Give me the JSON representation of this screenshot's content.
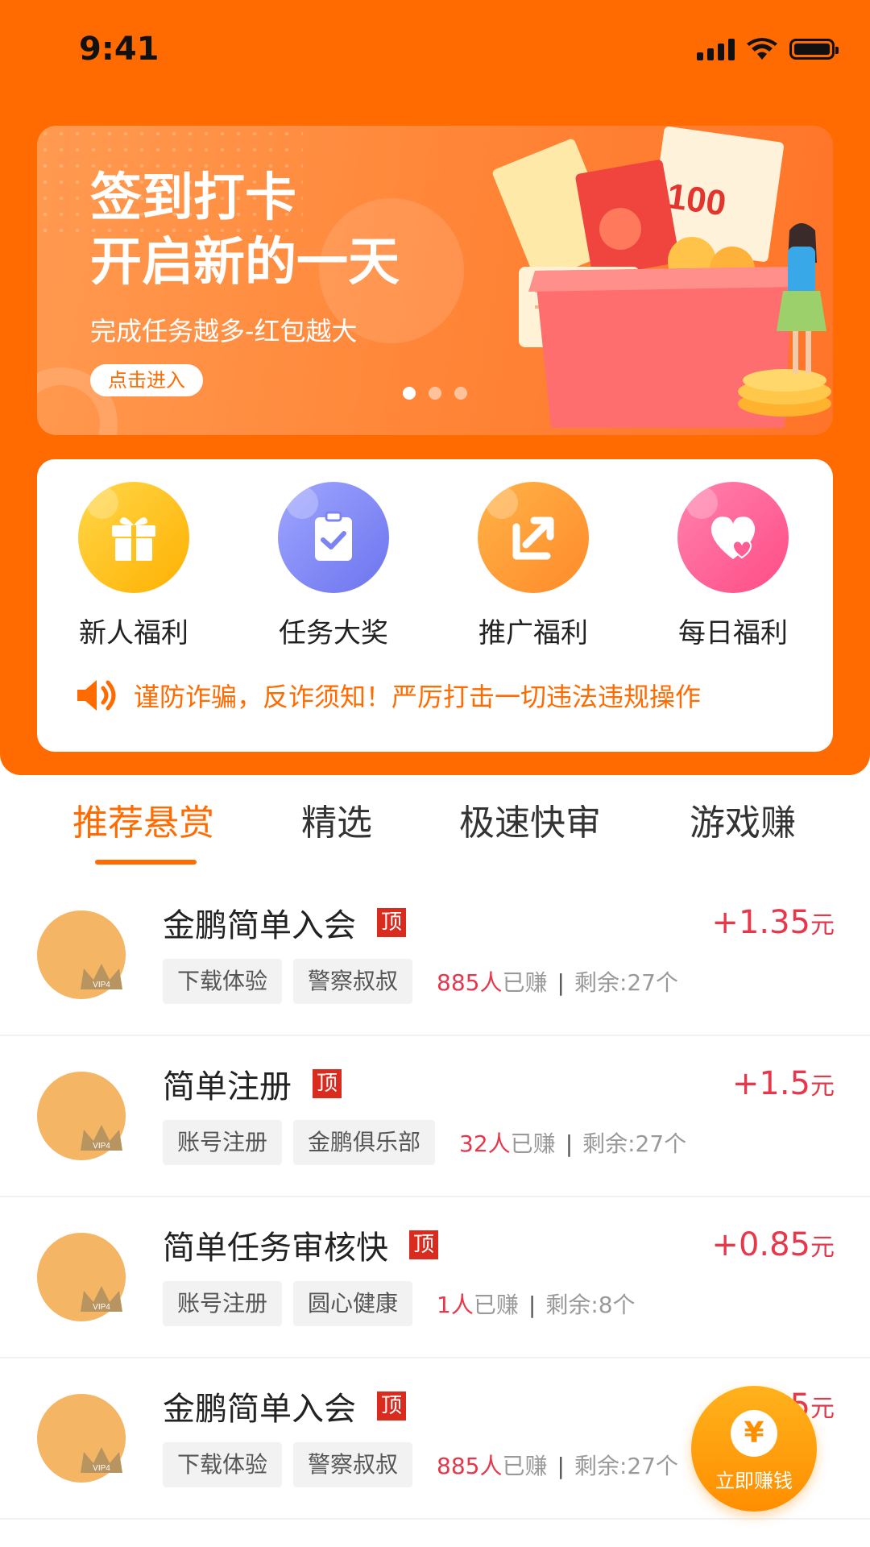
{
  "status_bar": {
    "time": "9:41"
  },
  "banner": {
    "title_line1": "签到打卡",
    "title_line2": "开启新的一天",
    "subtitle": "完成任务越多-红包越大",
    "button": "点击进入",
    "pages": 3,
    "active_page": 1
  },
  "quick_links": [
    {
      "label": "新人福利",
      "icon": "gift-icon",
      "color": "#FFC21D"
    },
    {
      "label": "任务大奖",
      "icon": "clipboard-check-icon",
      "color": "#7B84F0"
    },
    {
      "label": "推广福利",
      "icon": "share-arrow-icon",
      "color": "#FF9B3A"
    },
    {
      "label": "每日福利",
      "icon": "heart-icon",
      "color": "#FF5E95"
    }
  ],
  "notice": {
    "icon": "speaker-icon",
    "text": "谨防诈骗，反诈须知！严厉打击一切违法违规操作"
  },
  "tabs": [
    "推荐悬赏",
    "精选",
    "极速快审",
    "游戏赚"
  ],
  "active_tab": 0,
  "tasks": [
    {
      "title": "金鹏简单入会",
      "badge": "顶",
      "reward": "+1.35",
      "unit": "元",
      "tags": [
        "下载体验",
        "警察叔叔"
      ],
      "earned_count": "885人",
      "earned_suffix": "已赚",
      "remaining": "剩余:27个"
    },
    {
      "title": "简单注册",
      "badge": "顶",
      "reward": "+1.5",
      "unit": "元",
      "tags": [
        "账号注册",
        "金鹏俱乐部"
      ],
      "earned_count": "32人",
      "earned_suffix": "已赚",
      "remaining": "剩余:27个"
    },
    {
      "title": "简单任务审核快",
      "badge": "顶",
      "reward": "+0.85",
      "unit": "元",
      "tags": [
        "账号注册",
        "圆心健康"
      ],
      "earned_count": "1人",
      "earned_suffix": "已赚",
      "remaining": "剩余:8个"
    },
    {
      "title": "金鹏简单入会",
      "badge": "顶",
      "reward": "+1.35",
      "unit": "元",
      "tags": [
        "下载体验",
        "警察叔叔"
      ],
      "earned_count": "885人",
      "earned_suffix": "已赚",
      "remaining": "剩余:27个"
    }
  ],
  "fab": {
    "label": "立即赚钱",
    "coin": "¥"
  },
  "colors": {
    "brand": "#FF6B00",
    "reward": "#E8364B",
    "badge": "#D92C1F",
    "avatar": "#F4B565"
  }
}
